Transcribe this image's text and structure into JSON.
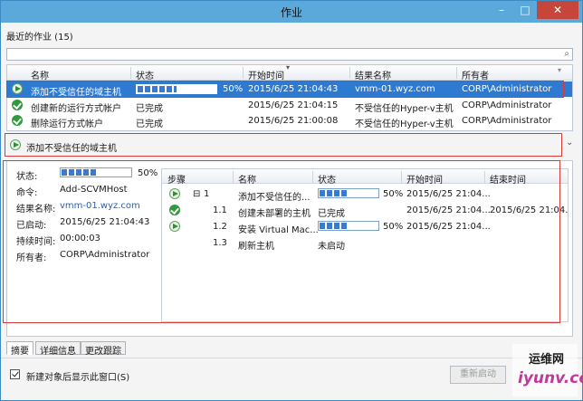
{
  "window": {
    "title": "作业",
    "min": "–",
    "max": "□",
    "close": "✕"
  },
  "recent": {
    "label": "最近的作业 (15)"
  },
  "search": {
    "placeholder": ""
  },
  "jobs": {
    "columns": [
      "名称",
      "状态",
      "开始时间",
      "结果名称",
      "所有者"
    ],
    "rows": [
      {
        "icon": "play-icon",
        "name": "添加不受信任的域主机",
        "status_progress": 50,
        "status_text": "50%",
        "start": "2015/6/25 21:04:43",
        "result": "vmm-01.wyz.com",
        "owner": "CORP\\Administrator",
        "selected": true
      },
      {
        "icon": "check-icon",
        "name": "创建新的运行方式帐户",
        "status_text": "已完成",
        "start": "2015/6/25 21:04:15",
        "result": "不受信任的Hyper-v主机",
        "owner": "CORP\\Administrator"
      },
      {
        "icon": "check-icon",
        "name": "删除运行方式帐户",
        "status_text": "已完成",
        "start": "2015/6/25 21:00:08",
        "result": "不受信任的Hyper-v主机",
        "owner": "CORP\\Administrator"
      }
    ]
  },
  "job_header": {
    "title": "添加不受信任的域主机",
    "collapse": "⌄"
  },
  "details": {
    "status_label": "状态:",
    "status_progress": 50,
    "status_text": "50%",
    "command_label": "命令:",
    "command": "Add-SCVMHost",
    "result_label": "结果名称:",
    "result": "vmm-01.wyz.com",
    "started_label": "已启动:",
    "started": "2015/6/25 21:04:43",
    "duration_label": "持续时间:",
    "duration": "00:00:03",
    "owner_label": "所有者:",
    "owner": "CORP\\Administrator"
  },
  "steps": {
    "columns": [
      "步骤",
      "名称",
      "状态",
      "开始时间",
      "结束时间"
    ],
    "rows": [
      {
        "icon": "play-icon",
        "expander": "⊟",
        "step": "1",
        "name": "添加不受信任的...",
        "progress": 50,
        "status_text": "50%",
        "start": "2015/6/25 21:04...",
        "end": ""
      },
      {
        "icon": "check-icon",
        "step": "1.1",
        "name": "创建未部署的主机",
        "status_text": "已完成",
        "start": "2015/6/25 21:04...",
        "end": "2015/6/25 21:04..."
      },
      {
        "icon": "play-icon",
        "step": "1.2",
        "name": "安装 Virtual Mac...",
        "progress": 50,
        "status_text": "50%",
        "start": "2015/6/25 21:04...",
        "end": ""
      },
      {
        "icon": "",
        "step": "1.3",
        "name": "刷新主机",
        "status_text": "未启动",
        "start": "",
        "end": ""
      }
    ]
  },
  "tabs": [
    "摘要",
    "详细信息",
    "更改跟踪"
  ],
  "footer": {
    "checkbox_label": "新建对象后显示此窗口(S)",
    "checked": true,
    "restart_label": "重新启动"
  },
  "watermark": {
    "line1": "运维网",
    "line2": "iyunv.com"
  },
  "colors": {
    "accent": "#2f7ad1",
    "titlebar": "#5ba9da",
    "highlight_box": "#d63a3a",
    "success": "#2e9a3a"
  }
}
